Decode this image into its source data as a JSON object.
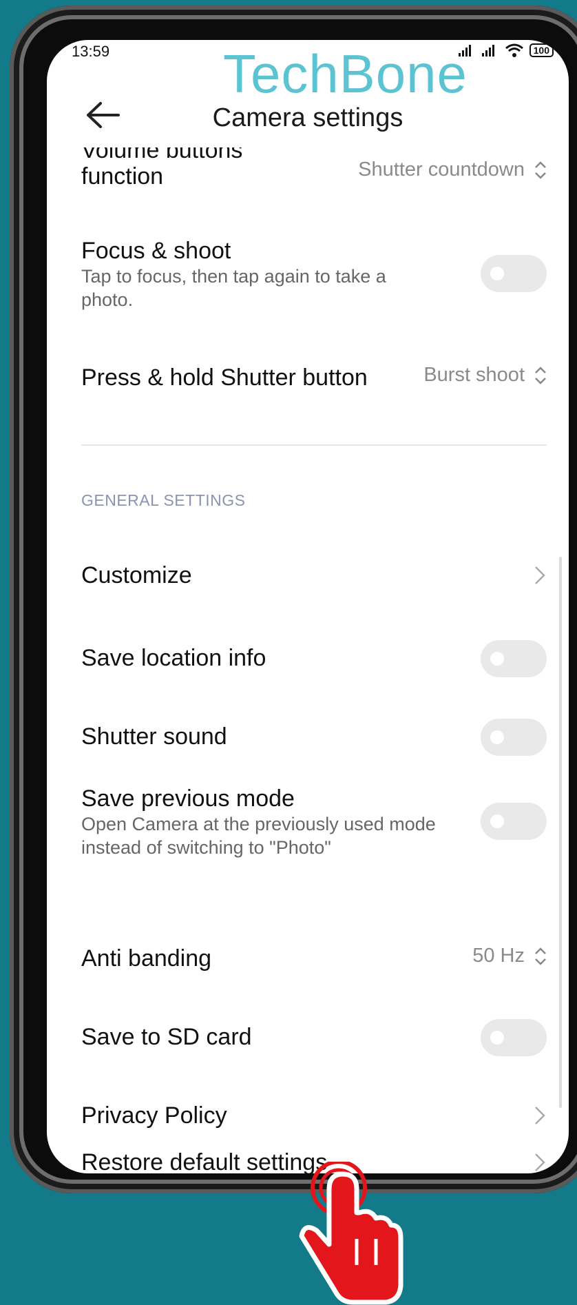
{
  "status_bar": {
    "time": "13:59",
    "battery": "100"
  },
  "watermark": "TechBone",
  "header": {
    "title": "Camera settings"
  },
  "items": {
    "volume": {
      "label_line1": "Volume buttons",
      "label_line2": "function",
      "value": "Shutter countdown"
    },
    "focus": {
      "label": "Focus & shoot",
      "sub_line1": "Tap to focus, then tap again to take a",
      "sub_line2": "photo."
    },
    "press_hold": {
      "label": "Press & hold Shutter button",
      "value": "Burst shoot"
    },
    "section_general": "GENERAL SETTINGS",
    "customize": {
      "label": "Customize"
    },
    "location": {
      "label": "Save location info"
    },
    "shutter_sound": {
      "label": "Shutter sound"
    },
    "previous_mode": {
      "label": "Save previous mode",
      "sub_line1": "Open Camera at the previously used mode",
      "sub_line2": "instead of switching to \"Photo\""
    },
    "anti_banding": {
      "label": "Anti banding",
      "value": "50 Hz"
    },
    "sd_card": {
      "label": "Save to SD card"
    },
    "privacy": {
      "label": "Privacy Policy"
    },
    "restore": {
      "label": "Restore default settings"
    }
  },
  "colors": {
    "background": "#137a8a",
    "watermark": "#5cc3d2",
    "touch_indicator": "#e3161b"
  }
}
